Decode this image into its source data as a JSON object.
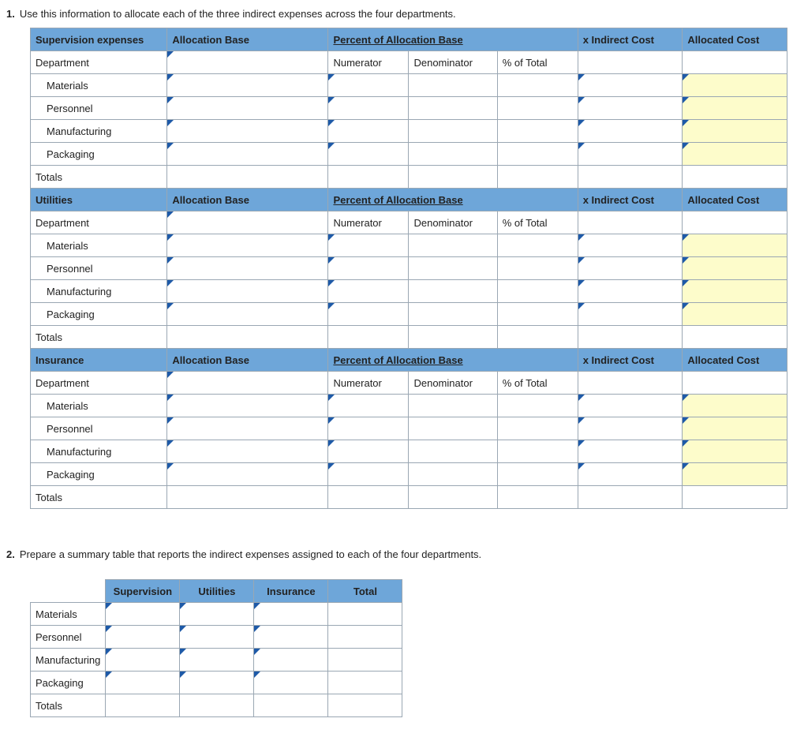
{
  "q1": {
    "num": "1.",
    "text": "Use this information to allocate each of the three indirect expenses across the four departments.",
    "sections": [
      {
        "title": "Supervision expenses",
        "alloc_base_label": "Allocation Base",
        "pab_label": "Percent of Allocation Base",
        "indirect_label": "x Indirect Cost",
        "allocated_label": "Allocated Cost",
        "dept_label": "Department",
        "num_label": "Numerator",
        "den_label": "Denominator",
        "pct_label": "% of Total",
        "rows": [
          "Materials",
          "Personnel",
          "Manufacturing",
          "Packaging"
        ],
        "totals_label": "Totals"
      },
      {
        "title": "Utilities",
        "alloc_base_label": "Allocation Base",
        "pab_label": "Percent of Allocation Base",
        "indirect_label": "x Indirect Cost",
        "allocated_label": "Allocated Cost",
        "dept_label": "Department",
        "num_label": "Numerator",
        "den_label": "Denominator",
        "pct_label": "% of Total",
        "rows": [
          "Materials",
          "Personnel",
          "Manufacturing",
          "Packaging"
        ],
        "totals_label": "Totals"
      },
      {
        "title": "Insurance",
        "alloc_base_label": "Allocation Base",
        "pab_label": "Percent of Allocation Base",
        "indirect_label": "x Indirect Cost",
        "allocated_label": "Allocated Cost",
        "dept_label": "Department",
        "num_label": "Numerator",
        "den_label": "Denominator",
        "pct_label": "% of Total",
        "rows": [
          "Materials",
          "Personnel",
          "Manufacturing",
          "Packaging"
        ],
        "totals_label": "Totals"
      }
    ]
  },
  "q2": {
    "num": "2.",
    "text": "Prepare a summary table that reports the indirect expenses assigned to each of the four departments.",
    "cols": [
      "Supervision",
      "Utilities",
      "Insurance",
      "Total"
    ],
    "rows": [
      "Materials",
      "Personnel",
      "Manufacturing",
      "Packaging",
      "Totals"
    ]
  }
}
